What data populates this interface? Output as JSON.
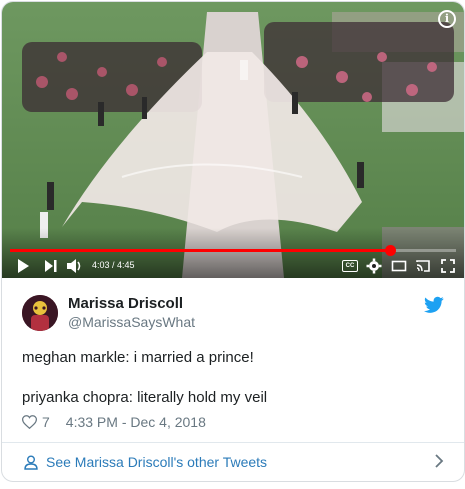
{
  "video": {
    "time_label": "4:03 / 4:45",
    "progress_fraction": 0.8526,
    "cc_label": "CC",
    "info_label": "i",
    "colors": {
      "progress": "#ff0000",
      "grass": "#5d8a4e"
    }
  },
  "tweet": {
    "display_name": "Marissa Driscoll",
    "handle": "@MarissaSaysWhat",
    "lines": [
      "meghan markle: i married a prince!",
      "priyanka chopra: literally hold my veil"
    ],
    "like_count": "7",
    "timestamp": "4:33 PM - Dec 4, 2018"
  },
  "footer": {
    "link_text": "See Marissa Driscoll's other Tweets"
  },
  "icons": {
    "brand": "twitter-bird-icon",
    "like": "heart-outline-icon",
    "profile": "person-icon",
    "more": "chevron-right-icon"
  },
  "colors": {
    "link": "#2b7bb9",
    "twitter_blue": "#1da1f2",
    "muted": "#697882"
  }
}
